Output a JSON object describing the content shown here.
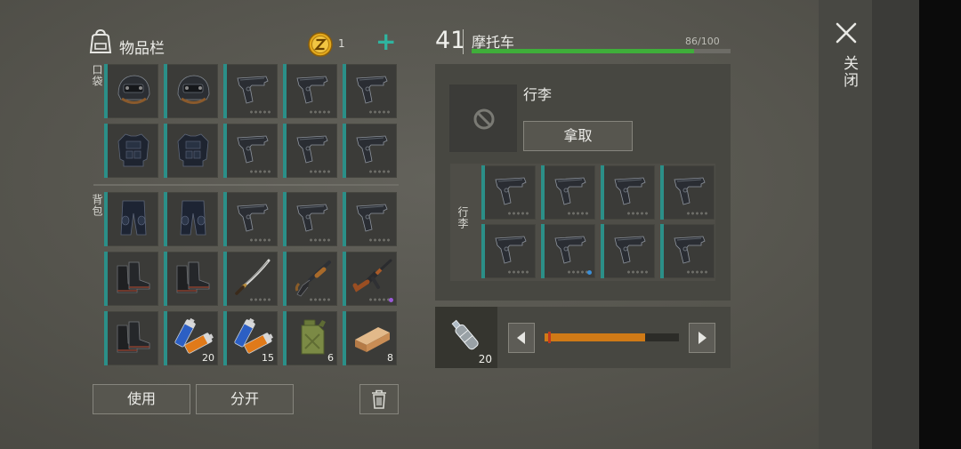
{
  "window": {
    "close_label": "关闭"
  },
  "inventory": {
    "title": "物品栏",
    "coins": "1",
    "add_symbol": "+",
    "pocket_label": "口袋",
    "backpack_label": "背包",
    "use_label": "使用",
    "split_label": "分开",
    "pocket_slots": [
      {
        "item": "helmet-icon"
      },
      {
        "item": "helmet-icon"
      },
      {
        "item": "pistol-icon"
      },
      {
        "item": "pistol-icon"
      },
      {
        "item": "pistol-icon"
      },
      {
        "item": "armor-vest-icon"
      },
      {
        "item": "armor-vest-icon"
      },
      {
        "item": "pistol-icon"
      },
      {
        "item": "pistol-icon"
      },
      {
        "item": "pistol-icon"
      }
    ],
    "backpack_slots": [
      {
        "item": "pants-icon"
      },
      {
        "item": "pants-icon"
      },
      {
        "item": "pistol-icon"
      },
      {
        "item": "pistol-icon"
      },
      {
        "item": "pistol-icon"
      },
      {
        "item": "boots-icon"
      },
      {
        "item": "boots-icon"
      },
      {
        "item": "katana-icon"
      },
      {
        "item": "shotgun-icon"
      },
      {
        "item": "assault-rifle-icon"
      },
      {
        "item": "boots-icon"
      },
      {
        "item": "battery-icon",
        "qty": "20"
      },
      {
        "item": "battery-icon",
        "qty": "15"
      },
      {
        "item": "jerrycan-icon",
        "qty": "6"
      },
      {
        "item": "wood-plank-icon",
        "qty": "8"
      }
    ]
  },
  "vehicle": {
    "level": "41",
    "name": "摩托车",
    "hp_text": "86/100",
    "hp_fraction": 0.86,
    "luggage_title": "行李",
    "take_label": "拿取",
    "luggage_grid_label": "行李",
    "luggage_slots": [
      {
        "item": "pistol-icon"
      },
      {
        "item": "pistol-icon"
      },
      {
        "item": "pistol-icon"
      },
      {
        "item": "pistol-icon"
      },
      {
        "item": "pistol-icon"
      },
      {
        "item": "pistol-icon"
      },
      {
        "item": "pistol-icon"
      },
      {
        "item": "pistol-icon"
      }
    ],
    "fuel_item": "water-bottle-icon",
    "fuel_qty": "20",
    "fuel_fraction": 0.75
  },
  "colors": {
    "accent_teal": "#2b8f88",
    "hp_green": "#3fae3a",
    "fuel_orange": "#d07a16",
    "rarity_purple": "#9a5ad8",
    "rarity_blue": "#3a8fd8"
  }
}
